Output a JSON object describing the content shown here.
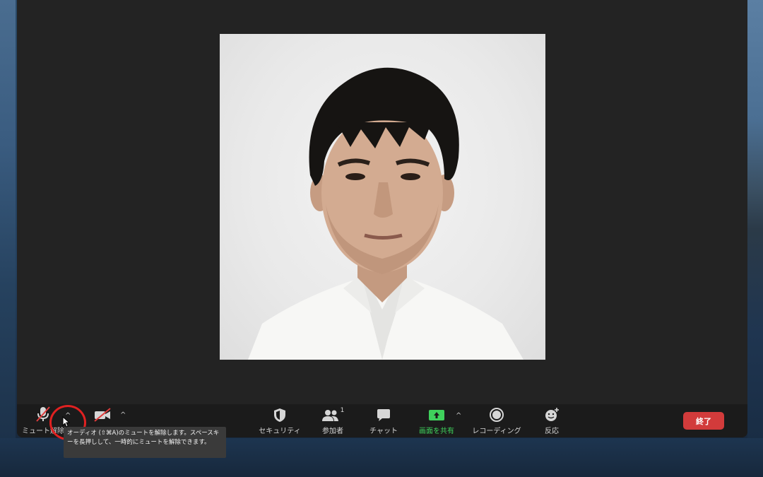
{
  "toolbar": {
    "unmute_label": "ミュート解除",
    "security_label": "セキュリティ",
    "participants_label": "参加者",
    "participants_count": "1",
    "chat_label": "チャット",
    "share_label": "画面を共有",
    "record_label": "レコーディング",
    "reactions_label": "反応",
    "end_label": "終了"
  },
  "tooltip": {
    "text": "オーディオ (⇧⌘A)のミュートを解除します。スペースキーを長押しして、一時的にミュートを解除できます。"
  },
  "icons": {
    "mic": "mic-muted-icon",
    "video": "video-off-icon",
    "security": "shield-icon",
    "participants": "people-icon",
    "chat": "chat-bubble-icon",
    "share": "share-screen-icon",
    "record": "record-icon",
    "reactions": "smiley-icon"
  },
  "colors": {
    "end": "#d23b3b",
    "share": "#3fd15c",
    "highlight": "#e02121"
  }
}
